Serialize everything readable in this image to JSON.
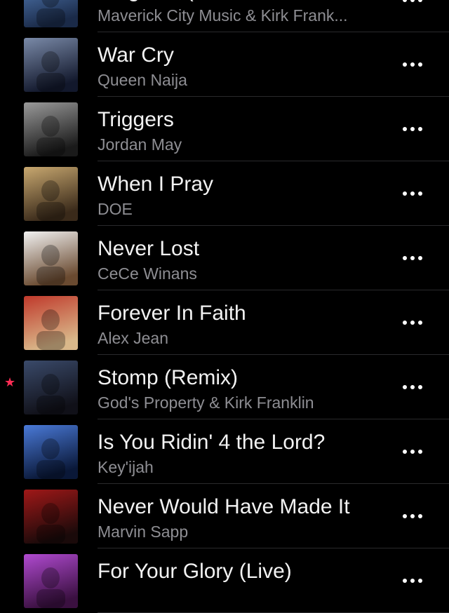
{
  "songs": [
    {
      "title": "Kingdom (feat. Naomi Rai...",
      "artist": "Maverick City Music & Kirk Frank...",
      "starred": false,
      "art_colors": [
        "#5a86c4",
        "#1a2a48"
      ]
    },
    {
      "title": "War Cry",
      "artist": "Queen Naija",
      "starred": false,
      "art_colors": [
        "#7a8aa8",
        "#12182c"
      ]
    },
    {
      "title": "Triggers",
      "artist": "Jordan May",
      "starred": false,
      "art_colors": [
        "#9a9a9a",
        "#1a1a1a"
      ]
    },
    {
      "title": "When I Pray",
      "artist": "DOE",
      "starred": false,
      "art_colors": [
        "#c8a870",
        "#3a2a1a"
      ]
    },
    {
      "title": "Never Lost",
      "artist": "CeCe Winans",
      "starred": false,
      "art_colors": [
        "#f2f2f2",
        "#6a4a30"
      ]
    },
    {
      "title": "Forever In Faith",
      "artist": "Alex Jean",
      "starred": false,
      "art_colors": [
        "#c0392b",
        "#d9b88a"
      ]
    },
    {
      "title": "Stomp (Remix)",
      "artist": "God's Property & Kirk Franklin",
      "starred": true,
      "art_colors": [
        "#3a4a6a",
        "#101018"
      ]
    },
    {
      "title": "Is You Ridin' 4 the Lord?",
      "artist": "Key'ijah",
      "starred": false,
      "art_colors": [
        "#4a7ad8",
        "#0a1838"
      ]
    },
    {
      "title": "Never Would Have Made It",
      "artist": "Marvin Sapp",
      "starred": false,
      "art_colors": [
        "#a01818",
        "#1a0a0a"
      ]
    },
    {
      "title": "For Your Glory (Live)",
      "artist": "",
      "starred": false,
      "art_colors": [
        "#b04ad0",
        "#3a1040"
      ]
    }
  ],
  "more_icon": "ellipsis-horizontal-icon",
  "star_icon": "star-icon",
  "star_glyph": "★",
  "colors": {
    "accent": "#ff2d55",
    "title": "#f2f2f2",
    "subtitle": "#8e8e93",
    "background": "#000000"
  }
}
